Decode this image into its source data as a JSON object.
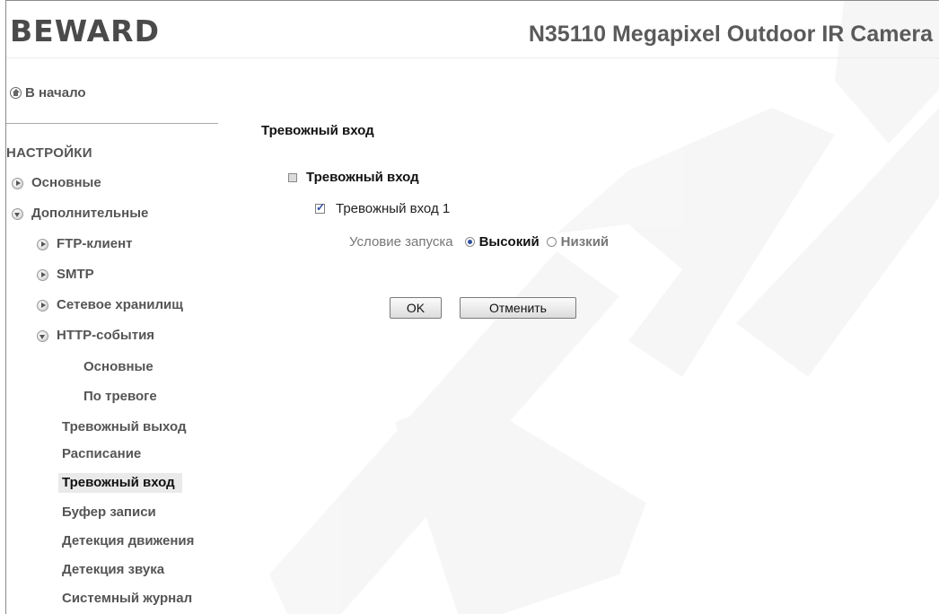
{
  "header": {
    "logo": "BEWARD",
    "product_title": "N35110 Megapixel Outdoor IR Camera"
  },
  "sidebar": {
    "home_label": "В начало",
    "section_title": "НАСТРОЙКИ",
    "items": [
      {
        "label": "Основные"
      },
      {
        "label": "Дополнительные"
      },
      {
        "label": "FTP-клиент"
      },
      {
        "label": "SMTP"
      },
      {
        "label": "Сетевое хранилищ"
      },
      {
        "label": "HTTP-события"
      },
      {
        "label": "Основные"
      },
      {
        "label": "По тревоге"
      },
      {
        "label": "Тревожный выход"
      },
      {
        "label": "Расписание"
      },
      {
        "label": "Тревожный вход"
      },
      {
        "label": "Буфер записи"
      },
      {
        "label": "Детекция движения"
      },
      {
        "label": "Детекция звука"
      },
      {
        "label": "Системный журнал"
      }
    ]
  },
  "main": {
    "page_title": "Тревожный вход",
    "group_title": "Тревожный вход",
    "input1_label": "Тревожный вход 1",
    "trigger_label": "Условие запуска",
    "option_high": "Высокий",
    "option_low": "Низкий",
    "ok_button": "OK",
    "cancel_button": "Отменить"
  }
}
